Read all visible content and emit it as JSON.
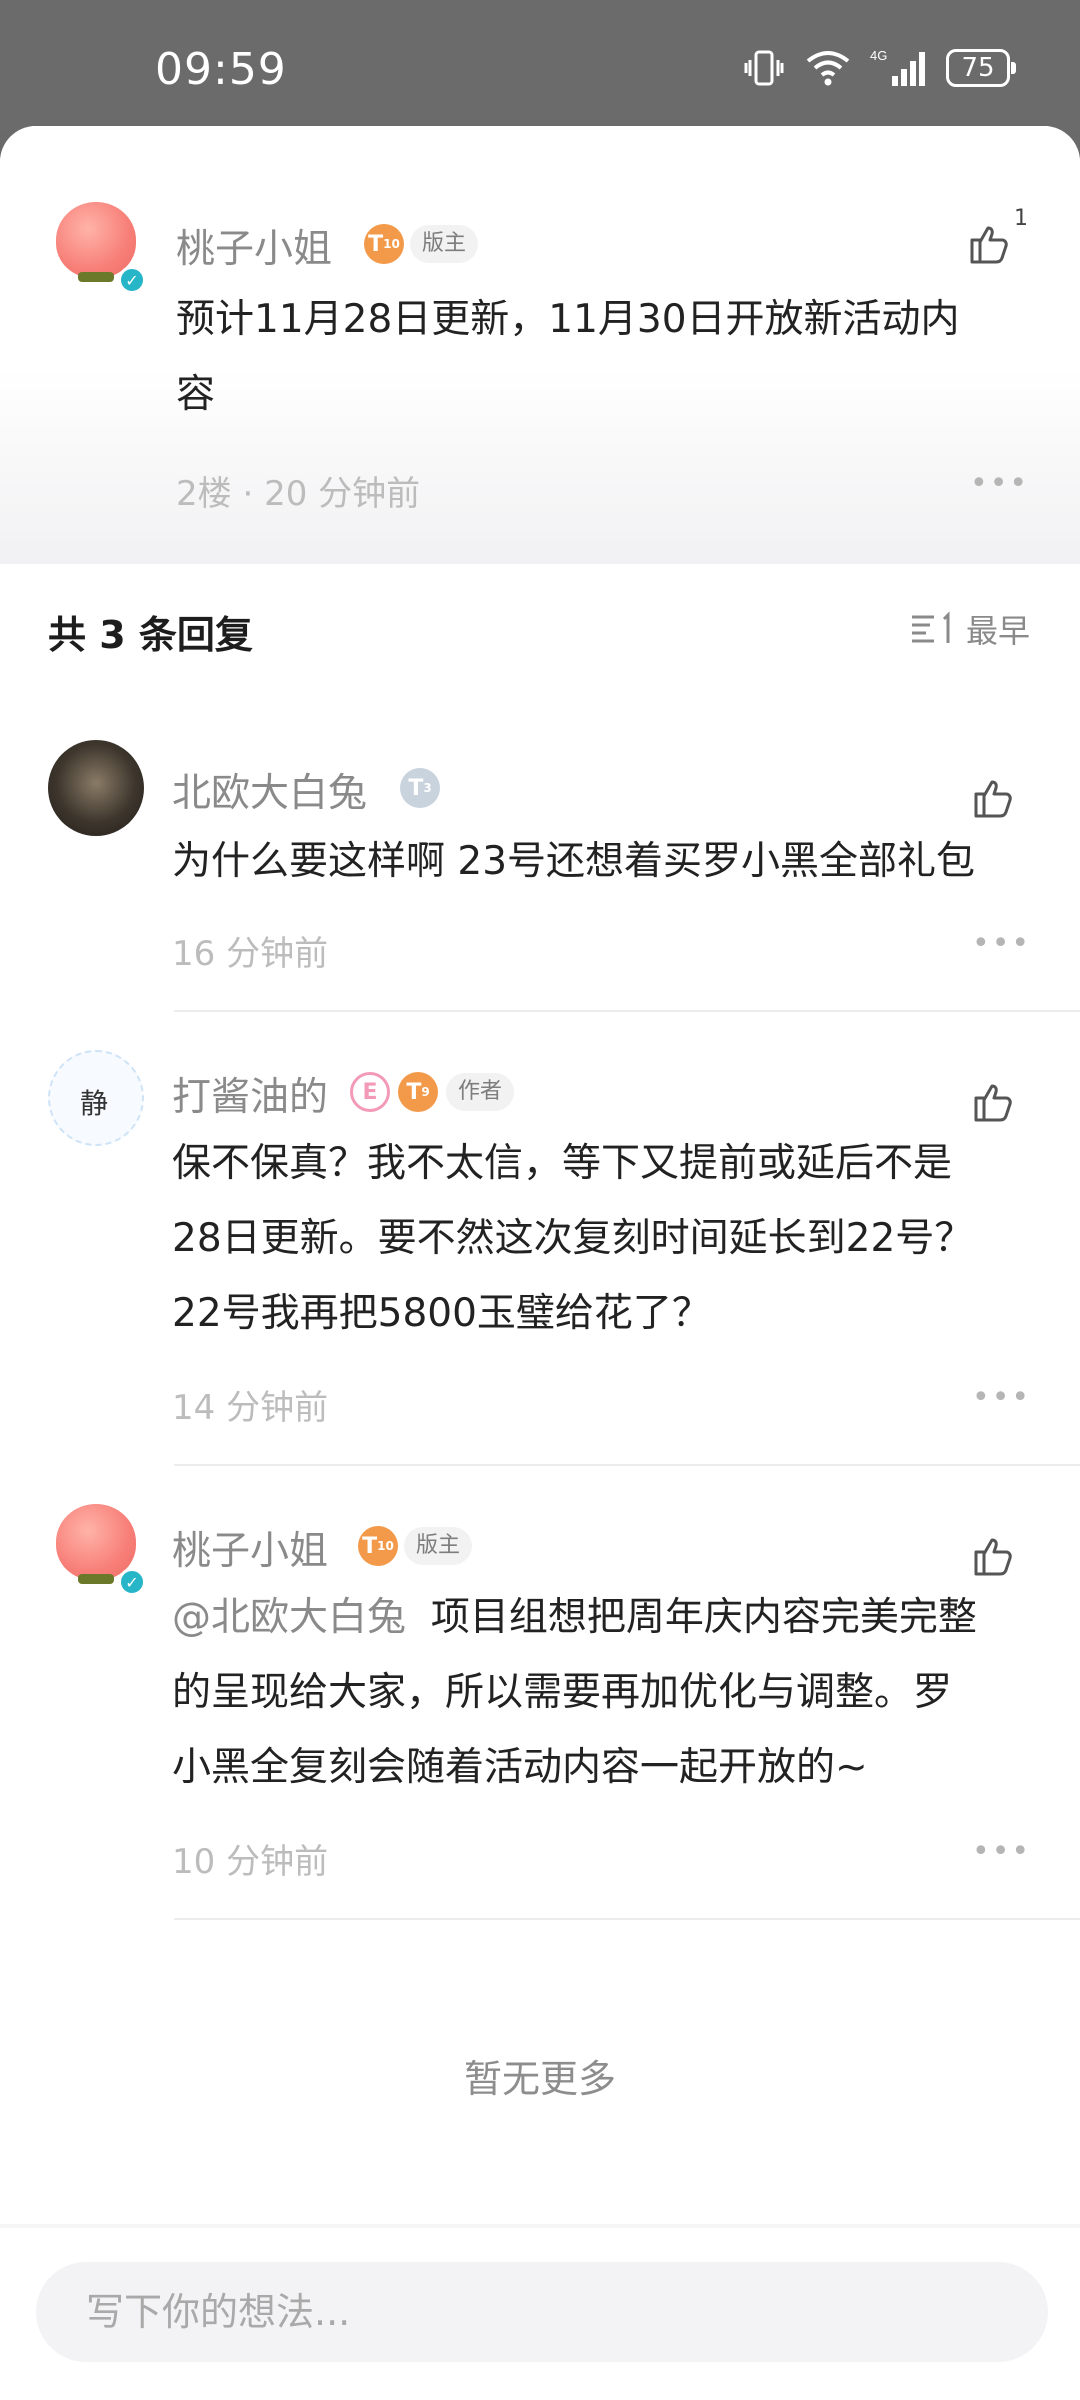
{
  "status_bar": {
    "time": "09:59",
    "network": "4G",
    "battery": "75"
  },
  "main_post": {
    "author": "桃子小姐",
    "level": "10",
    "role": "版主",
    "content_line1": "预计11月28日更新，11月30日开放新活动内",
    "content_line2": "容",
    "floor": "2楼",
    "time_ago": "20 分钟前",
    "like_count": "1"
  },
  "replies_header": {
    "title": "共 3 条回复",
    "sort_label": "最早"
  },
  "replies": [
    {
      "author": "北欧大白兔",
      "level": "3",
      "content": "为什么要这样啊 23号还想着买罗小黑全部礼包",
      "time_ago": "16 分钟前"
    },
    {
      "author": "打酱油的",
      "badge": "E",
      "level": "9",
      "role": "作者",
      "avatar_text": "静",
      "content_line1": "保不保真？我不太信，等下又提前或延后不是",
      "content_line2": "28日更新。要不然这次复刻时间延长到22号？",
      "content_line3": "22号我再把5800玉璧给花了？",
      "time_ago": "14 分钟前"
    },
    {
      "author": "桃子小姐",
      "level": "10",
      "role": "版主",
      "mention": "@北欧大白兔",
      "content_line1": "项目组想把周年庆内容完美完整",
      "content_line2": "的呈现给大家，所以需要再加优化与调整。罗",
      "content_line3": "小黑全复刻会随着活动内容一起开放的~",
      "time_ago": "10 分钟前"
    }
  ],
  "footer": {
    "no_more": "暂无更多"
  },
  "input": {
    "placeholder": "写下你的想法..."
  },
  "colors": {
    "level_badge": "#f39a4a",
    "verify": "#27b5c8",
    "meta_text": "#bcbcbc"
  }
}
